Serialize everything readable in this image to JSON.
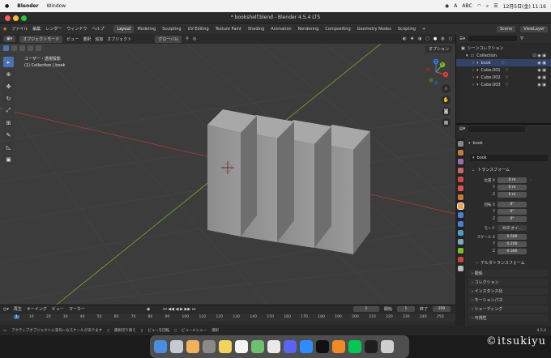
{
  "mac": {
    "app": "Blender",
    "menu": "Window",
    "input": "A",
    "abc": "ABC",
    "datetime": "12月5日(金) 11:16"
  },
  "window": {
    "title": "* bookshelf.blend - Blender 4.5.4 LTS"
  },
  "menubar": {
    "items": [
      "ファイル",
      "編集",
      "レンダー",
      "ウィンドウ",
      "ヘルプ"
    ],
    "tabs": [
      "Layout",
      "Modeling",
      "Sculpting",
      "UV Editing",
      "Texture Paint",
      "Shading",
      "Animation",
      "Rendering",
      "Compositing",
      "Geometry Nodes",
      "Scripting"
    ],
    "active_tab": "Layout",
    "scene": "Scene",
    "view_layer": "ViewLayer"
  },
  "viewport": {
    "mode": "オブジェクトモード",
    "menus": [
      "ビュー",
      "選択",
      "追加",
      "オブジェクト"
    ],
    "transform": "グローバル",
    "options": "オプション",
    "view_name": "ユーザー・透視投影",
    "collection_line": "(1) Collection | book"
  },
  "gizmo": {
    "x": "X",
    "y": "Y",
    "z": "Z"
  },
  "outliner": {
    "search_ph": "",
    "root": "シーンコレクション",
    "collection": "Collection",
    "items": [
      "book",
      "Cube.001",
      "Cube.002",
      "Cube.003"
    ]
  },
  "properties": {
    "search_ph": "",
    "object": "book",
    "object_name": "book",
    "transform_title": "トランスフォーム",
    "loc_label": "位置 X",
    "rot_label": "回転 X",
    "scale_label": "スケール X",
    "axis_y": "Y",
    "axis_z": "Z",
    "mode_label": "モード",
    "mode_value": "XYZ オイ…",
    "loc": [
      "0 m",
      "0 m",
      "0 m"
    ],
    "rot": [
      "0°",
      "0°",
      "0°"
    ],
    "scale": [
      "0.500",
      "0.200",
      "0.300"
    ],
    "delta": "デルタトランスフォーム",
    "sections": [
      "関係",
      "コレクション",
      "インスタンス化",
      "モーションパス",
      "シェーディング",
      "可視性"
    ]
  },
  "timeline": {
    "menus": [
      "再生",
      "キーイング",
      "ビュー",
      "マーカー"
    ],
    "frame": "1",
    "start_label": "開始",
    "start": "1",
    "end_label": "終了",
    "end": "250",
    "ticks": [
      "1",
      "10",
      "20",
      "30",
      "40",
      "50",
      "60",
      "70",
      "80",
      "90",
      "100",
      "110",
      "120",
      "130",
      "140",
      "150",
      "160",
      "170",
      "180",
      "190",
      "200",
      "210",
      "220",
      "230",
      "240",
      "250"
    ]
  },
  "status": {
    "msg": "アクティブオブジェクトに非均一なスケールがあります",
    "select": "選択切り替え",
    "pan": "ビューを回転",
    "context": "ビューメニュー",
    "extra": "選択",
    "version": "4.5.4"
  },
  "dock": [
    "Finder",
    "Launchpad",
    "Photos",
    "Settings",
    "Notes",
    "Freeform",
    "Maps",
    "Chrome",
    "Discord",
    "zoom",
    "CapCut",
    "Blender",
    "LINE",
    "Figma",
    "Trash"
  ],
  "watermark": "©itsukiyu",
  "colors": {
    "accent": "#4772b3",
    "xaxis": "#b33a3a",
    "yaxis": "#7aa82a",
    "gizmo_x": "#e0453b",
    "gizmo_y": "#7cbd2b",
    "gizmo_z": "#3f7be0"
  }
}
